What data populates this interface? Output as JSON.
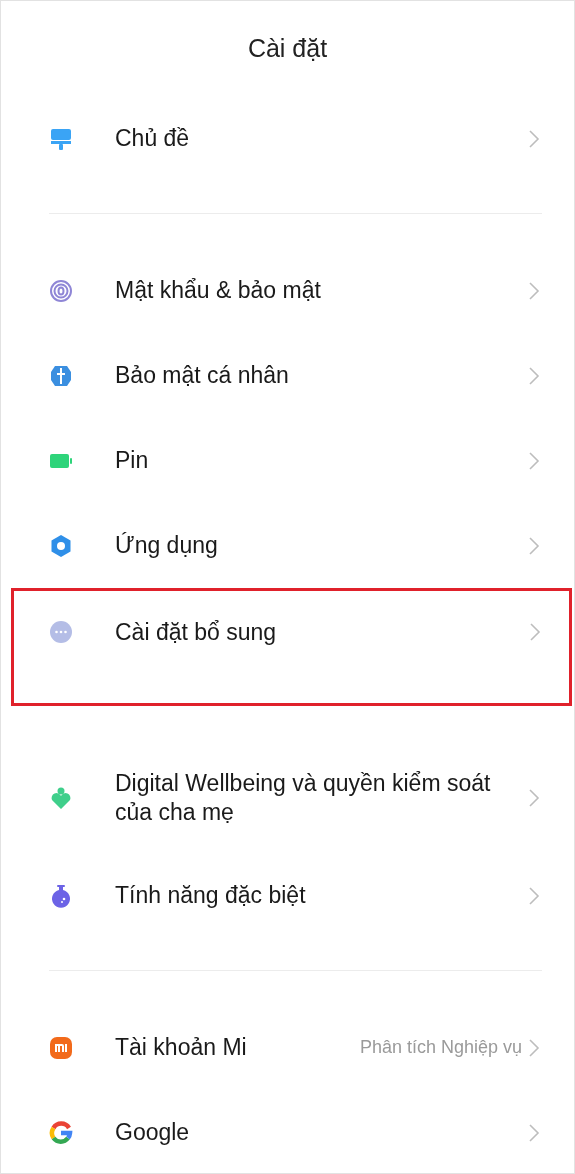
{
  "title": "Cài đặt",
  "groups": [
    {
      "items": [
        {
          "kind": "theme",
          "label": "Chủ đề",
          "highlighted": false
        }
      ]
    },
    {
      "divider": true,
      "items": [
        {
          "kind": "fingerprint",
          "label": "Mật khẩu & bảo mật",
          "highlighted": false
        },
        {
          "kind": "shield",
          "label": "Bảo mật cá nhân",
          "highlighted": false
        },
        {
          "kind": "battery",
          "label": "Pin",
          "highlighted": false
        },
        {
          "kind": "gear",
          "label": "Ứng dụng",
          "highlighted": false
        },
        {
          "kind": "more",
          "label": "Cài đặt bổ sung",
          "highlighted": true
        }
      ]
    },
    {
      "divider": false,
      "items": [
        {
          "kind": "wellbeing",
          "label": "Digital Wellbeing và quyền kiểm soát của cha mẹ",
          "highlighted": false
        },
        {
          "kind": "flask",
          "label": "Tính năng đặc biệt",
          "highlighted": false
        }
      ]
    },
    {
      "divider": true,
      "items": [
        {
          "kind": "mi",
          "label": "Tài khoản Mi",
          "value": "Phân tích Nghiệp vụ",
          "highlighted": false
        },
        {
          "kind": "google",
          "label": "Google",
          "highlighted": false
        }
      ]
    }
  ]
}
